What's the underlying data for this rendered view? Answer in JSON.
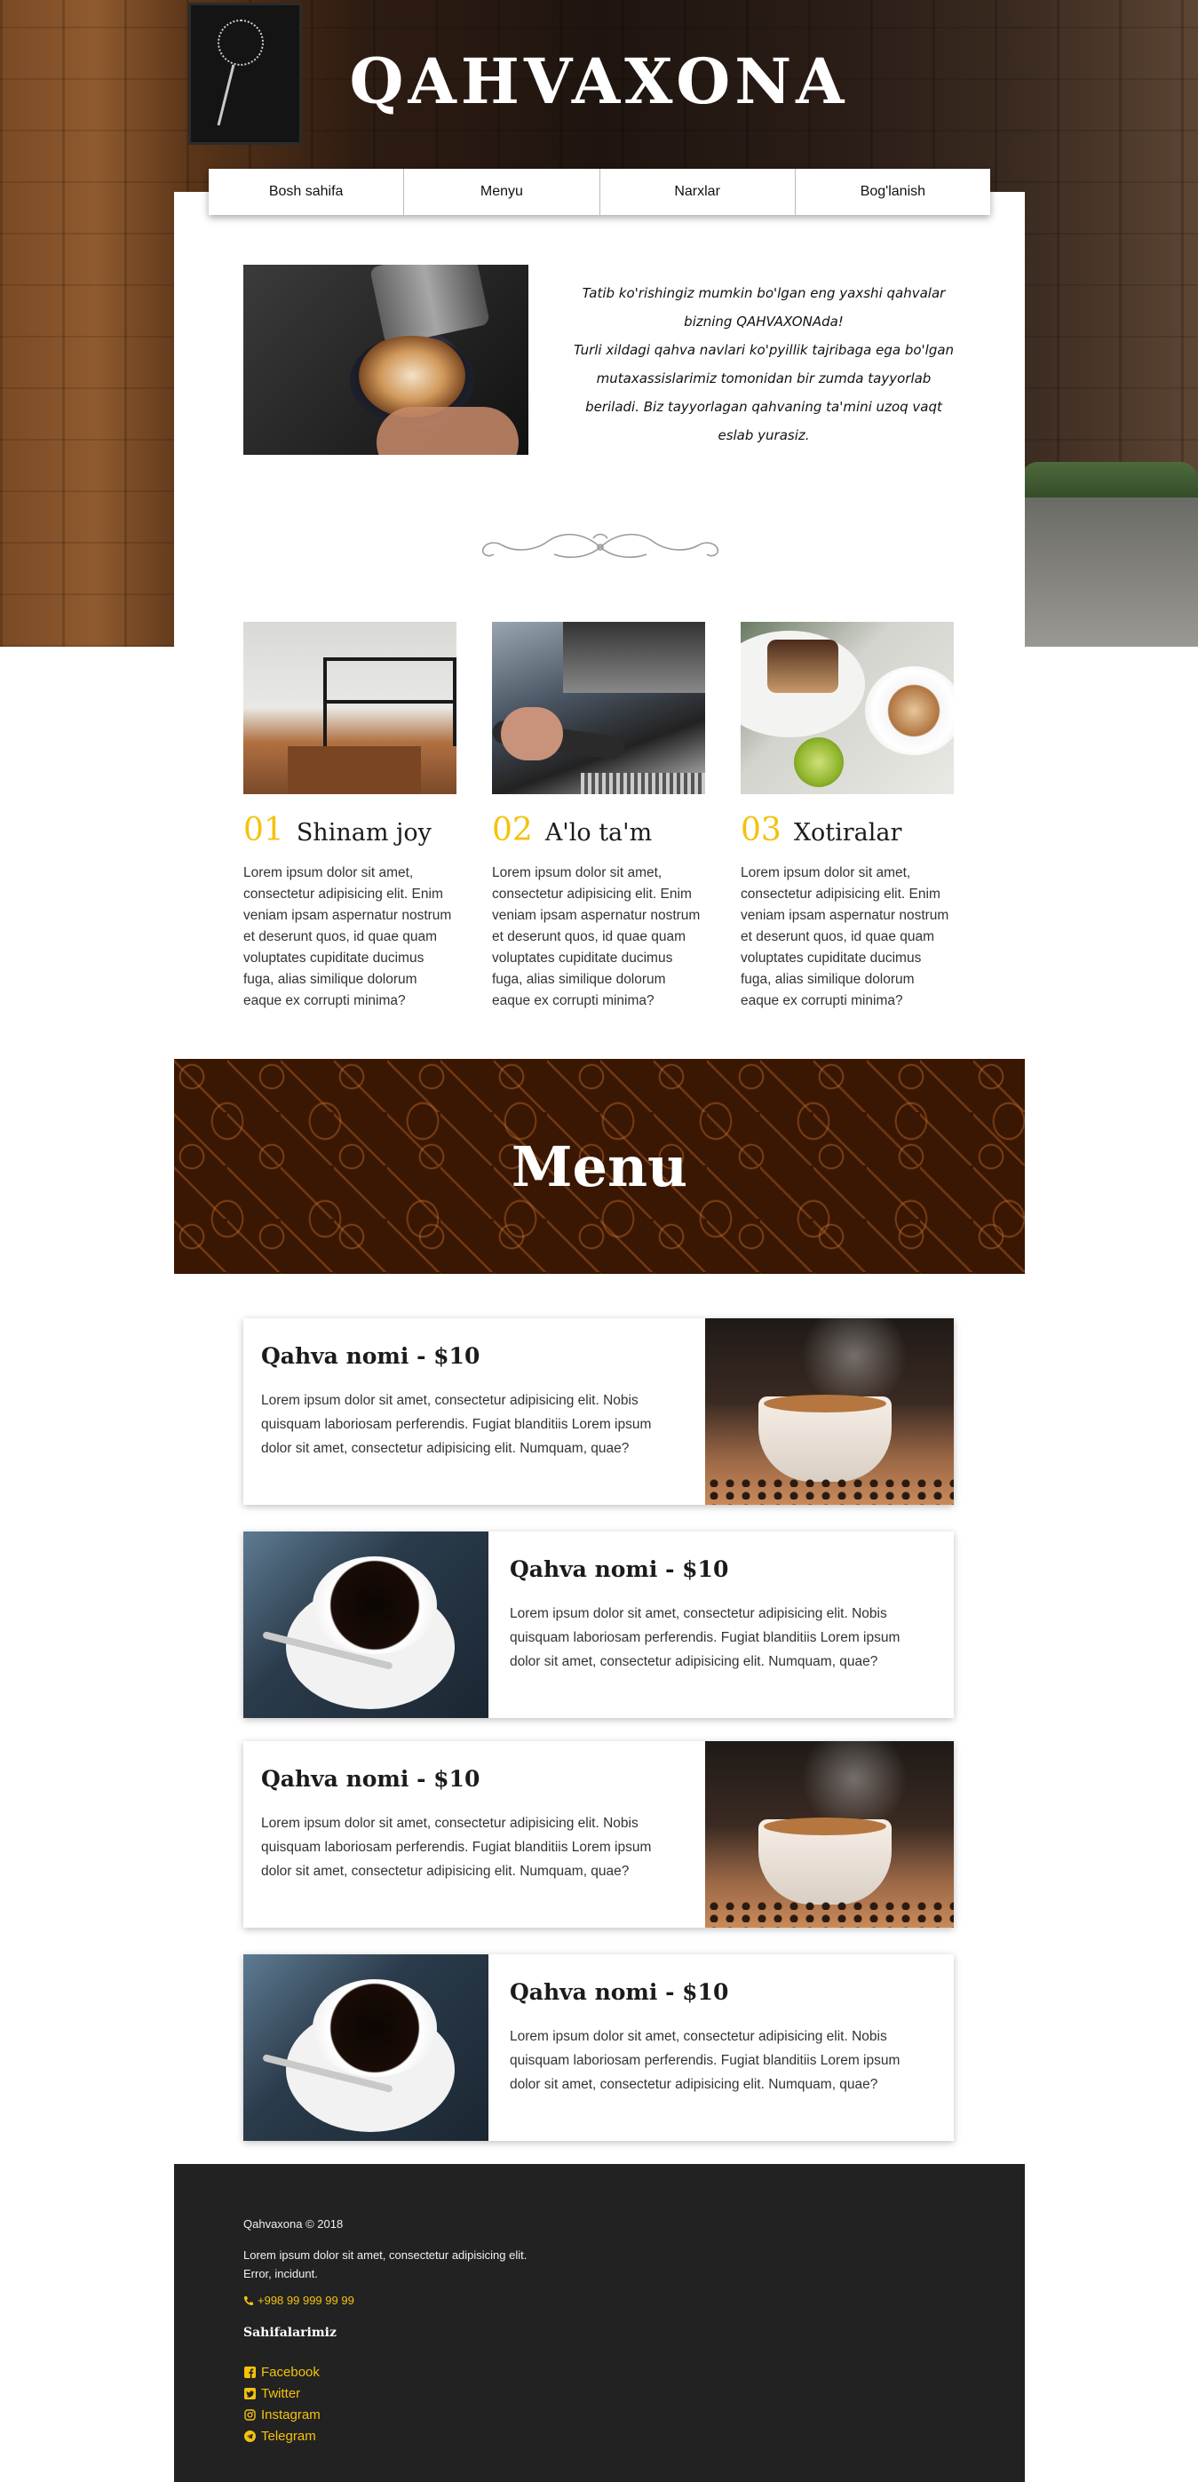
{
  "site": {
    "title": "QAHVAXONA"
  },
  "nav": {
    "items": [
      {
        "label": "Bosh sahifa"
      },
      {
        "label": "Menyu"
      },
      {
        "label": "Narxlar"
      },
      {
        "label": "Bog'lanish"
      }
    ]
  },
  "intro": {
    "lines": [
      "Tatib ko'rishingiz mumkin bo'lgan eng yaxshi qahvalar",
      "bizning QAHVAXONAda!",
      "Turli xildagi qahva navlari ko'pyillik tajribaga ega bo'lgan",
      "mutaxassislarimiz tomonidan bir zumda tayyorlab",
      "beriladi. Biz tayyorlagan qahvaning ta'mini uzoq vaqt",
      "eslab yurasiz."
    ]
  },
  "features": [
    {
      "num": "01",
      "title": "Shinam joy",
      "desc": "Lorem ipsum dolor sit amet, consectetur adipisicing elit. Enim veniam ipsam aspernatur nostrum et deserunt quos, id quae quam voluptates cupiditate ducimus fuga, alias similique dolorum eaque ex corrupti minima?"
    },
    {
      "num": "02",
      "title": "A'lo ta'm",
      "desc": "Lorem ipsum dolor sit amet, consectetur adipisicing elit. Enim veniam ipsam aspernatur nostrum et deserunt quos, id quae quam voluptates cupiditate ducimus fuga, alias similique dolorum eaque ex corrupti minima?"
    },
    {
      "num": "03",
      "title": "Xotiralar",
      "desc": "Lorem ipsum dolor sit amet, consectetur adipisicing elit. Enim veniam ipsam aspernatur nostrum et deserunt quos, id quae quam voluptates cupiditate ducimus fuga, alias similique dolorum eaque ex corrupti minima?"
    }
  ],
  "menu": {
    "banner_title": "Menu",
    "items": [
      {
        "name": "Qahva nomi - $10",
        "desc": "Lorem ipsum dolor sit amet, consectetur adipisicing elit. Nobis quisquam laboriosam perferendis. Fugiat blanditiis Lorem ipsum dolor sit amet, consectetur adipisicing elit. Numquam, quae?"
      },
      {
        "name": "Qahva nomi - $10",
        "desc": "Lorem ipsum dolor sit amet, consectetur adipisicing elit. Nobis quisquam laboriosam perferendis. Fugiat blanditiis Lorem ipsum dolor sit amet, consectetur adipisicing elit. Numquam, quae?"
      },
      {
        "name": "Qahva nomi - $10",
        "desc": "Lorem ipsum dolor sit amet, consectetur adipisicing elit. Nobis quisquam laboriosam perferendis. Fugiat blanditiis Lorem ipsum dolor sit amet, consectetur adipisicing elit. Numquam, quae?"
      },
      {
        "name": "Qahva nomi - $10",
        "desc": "Lorem ipsum dolor sit amet, consectetur adipisicing elit. Nobis quisquam laboriosam perferendis. Fugiat blanditiis Lorem ipsum dolor sit amet, consectetur adipisicing elit. Numquam, quae?"
      }
    ]
  },
  "footer": {
    "copyright": "Qahvaxona © 2018",
    "about_line1": "Lorem ipsum dolor sit amet, consectetur adipisicing elit.",
    "about_line2": "Error, incidunt.",
    "phone": "+998 99 999 99 99",
    "pages_title": "Sahifalarimiz",
    "social": [
      {
        "label": "Facebook",
        "icon": "facebook-icon"
      },
      {
        "label": "Twitter",
        "icon": "twitter-icon"
      },
      {
        "label": "Instagram",
        "icon": "instagram-icon"
      },
      {
        "label": "Telegram",
        "icon": "telegram-icon"
      }
    ]
  },
  "colors": {
    "accent": "#f4c20d",
    "banner_bg": "#3a1703",
    "footer_bg": "#222222"
  }
}
